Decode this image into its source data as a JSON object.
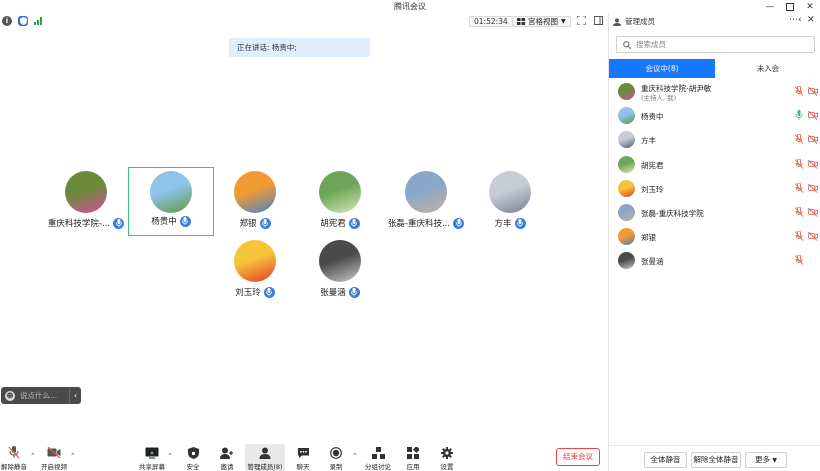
{
  "window": {
    "title": "腾讯会议",
    "controls": [
      "minimize-icon",
      "maximize-icon",
      "close-icon"
    ]
  },
  "topbar": {
    "icons": [
      "info-icon",
      "shield-icon",
      "signal-icon"
    ],
    "timer": "01:52:34",
    "view_label": "宫格视图",
    "right_icons": [
      "fullscreen-icon",
      "sidebar-toggle-icon"
    ]
  },
  "speaking": {
    "text": "正在讲话: 杨贵中;"
  },
  "participants": [
    {
      "name": "重庆科技学院-...",
      "active": false,
      "avatar_colors": [
        "#6a8a3a",
        "#d24f9e"
      ],
      "mic": "on"
    },
    {
      "name": "杨贵中",
      "active": true,
      "avatar_colors": [
        "#8ec3ea",
        "#5c9a3a"
      ],
      "mic": "on"
    },
    {
      "name": "郑银",
      "active": false,
      "avatar_colors": [
        "#f29a32",
        "#4a82c8"
      ],
      "mic": "on"
    },
    {
      "name": "胡宪君",
      "active": false,
      "avatar_colors": [
        "#6fa55a",
        "#d7e9b8"
      ],
      "mic": "on"
    },
    {
      "name": "张磊-重庆科技...",
      "active": false,
      "avatar_colors": [
        "#8aa6c8",
        "#c0b2a0"
      ],
      "mic": "on"
    },
    {
      "name": "方丰",
      "active": false,
      "avatar_colors": [
        "#c7ccd6",
        "#7a7f90"
      ],
      "mic": "on"
    },
    {
      "name": "刘玉玲",
      "active": false,
      "avatar_colors": [
        "#f6c43a",
        "#e23a2a"
      ],
      "mic": "on"
    },
    {
      "name": "张曼涵",
      "active": false,
      "avatar_colors": [
        "#4a4a4a",
        "#c9c9c9"
      ],
      "mic": "on"
    }
  ],
  "chat": {
    "placeholder": "说点什么...",
    "collapse_icon": "chevron-left-icon"
  },
  "toolbar": {
    "unmute": "解除静音",
    "video": "开启视频",
    "share": "共享屏幕",
    "security": "安全",
    "invite": "邀请",
    "members": "管理成员(8)",
    "chat": "聊天",
    "record": "录制",
    "breakout": "分组讨论",
    "apps": "应用",
    "settings": "设置",
    "end": "结束会议"
  },
  "panel": {
    "title": "管理成员",
    "search_placeholder": "搜索成员",
    "tab_in_meeting": "会议中(8)",
    "tab_not_joined": "未入会",
    "members": [
      {
        "name": "重庆科技学院-胡尹敏",
        "sub": "(主持人, 我)",
        "avatar_colors": [
          "#6a8a3a",
          "#d24f9e"
        ],
        "mic": "muted",
        "video": "off"
      },
      {
        "name": "杨贵中",
        "sub": "",
        "avatar_colors": [
          "#8ec3ea",
          "#5c9a3a"
        ],
        "mic": "speaking",
        "video": "off"
      },
      {
        "name": "方丰",
        "sub": "",
        "avatar_colors": [
          "#c7ccd6",
          "#4a5a7a"
        ],
        "mic": "muted",
        "video": "off"
      },
      {
        "name": "胡宪君",
        "sub": "",
        "avatar_colors": [
          "#6fa55a",
          "#d7e9b8"
        ],
        "mic": "muted",
        "video": "off"
      },
      {
        "name": "刘玉玲",
        "sub": "",
        "avatar_colors": [
          "#f6c43a",
          "#e23a2a"
        ],
        "mic": "muted",
        "video": "off"
      },
      {
        "name": "张磊-重庆科技学院",
        "sub": "",
        "avatar_colors": [
          "#8aa6c8",
          "#c0b2a0"
        ],
        "mic": "muted",
        "video": "off"
      },
      {
        "name": "郑银",
        "sub": "",
        "avatar_colors": [
          "#f29a32",
          "#4a82c8"
        ],
        "mic": "muted",
        "video": "off"
      },
      {
        "name": "张曼涵",
        "sub": "",
        "avatar_colors": [
          "#4a4a4a",
          "#c9c9c9"
        ],
        "mic": "muted",
        "video": "none"
      }
    ],
    "mute_all": "全体静音",
    "unmute_all": "解除全体静音",
    "more": "更多"
  },
  "colors": {
    "accent": "#1677ff",
    "active_border": "#3cc27c",
    "muted_red": "#e5544c",
    "speaking_green": "#3cc27c",
    "end_red": "#e33333"
  }
}
